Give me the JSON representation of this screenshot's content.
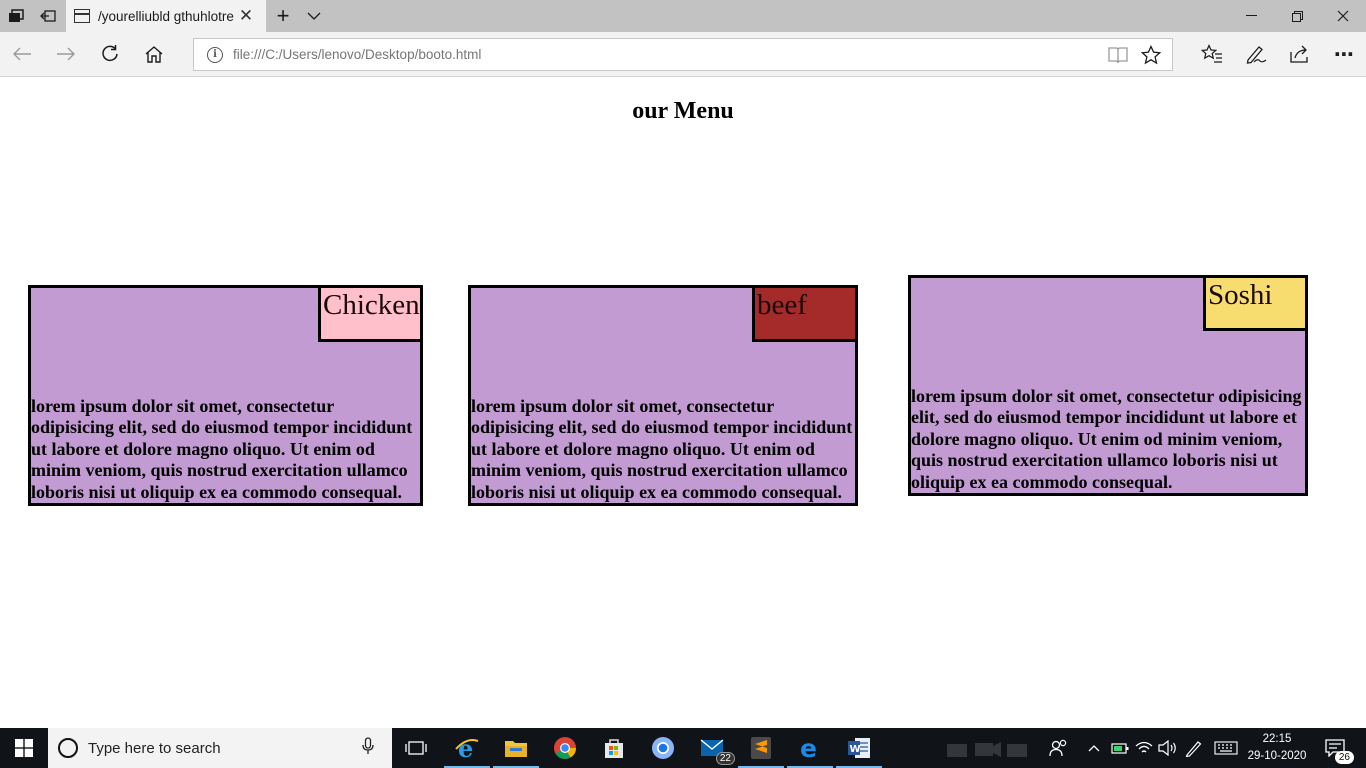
{
  "browser": {
    "tab_title": "/yourelliubld gthuhlotre",
    "tab_close": "✕",
    "new_tab": "+",
    "tab_list": "⌄",
    "window_minimize": "—",
    "window_restore": "❐",
    "window_close": "✕",
    "address": "file:///C:/Users/lenovo/Desktop/booto.html",
    "info_glyph": "i",
    "more_label": "⋯"
  },
  "page": {
    "title": "our Menu",
    "cards": [
      {
        "name": "Chicken",
        "color": "#ffc0cb",
        "text": "lorem ipsum dolor sit omet, consectetur odipisicing elit, sed do eiusmod tempor incididunt ut labore et dolore magno oliquo. Ut enim od minim veniom, quis nostrud exercitation ullamco loboris nisi ut oliquip ex ea commodo consequal."
      },
      {
        "name": "beef",
        "color": "#a52a2a",
        "text": "lorem ipsum dolor sit omet, consectetur odipisicing elit, sed do eiusmod tempor incididunt ut labore et dolore magno oliquo. Ut enim od minim veniom, quis nostrud exercitation ullamco loboris nisi ut oliquip ex ea commodo consequal."
      },
      {
        "name": "Soshi",
        "color": "#f7dc6f",
        "text": "lorem ipsum dolor sit omet, consectetur odipisicing elit, sed do eiusmod tempor incididunt ut labore et dolore magno oliquo. Ut enim od minim veniom, quis nostrud exercitation ullamco loboris nisi ut oliquip ex ea commodo consequal."
      }
    ],
    "card_background": "#c39bd3"
  },
  "taskbar": {
    "search_placeholder": "Type here to search",
    "mail_badge": "22",
    "clock_time": "22:15",
    "clock_date": "29-10-2020",
    "notification_count": "26"
  }
}
